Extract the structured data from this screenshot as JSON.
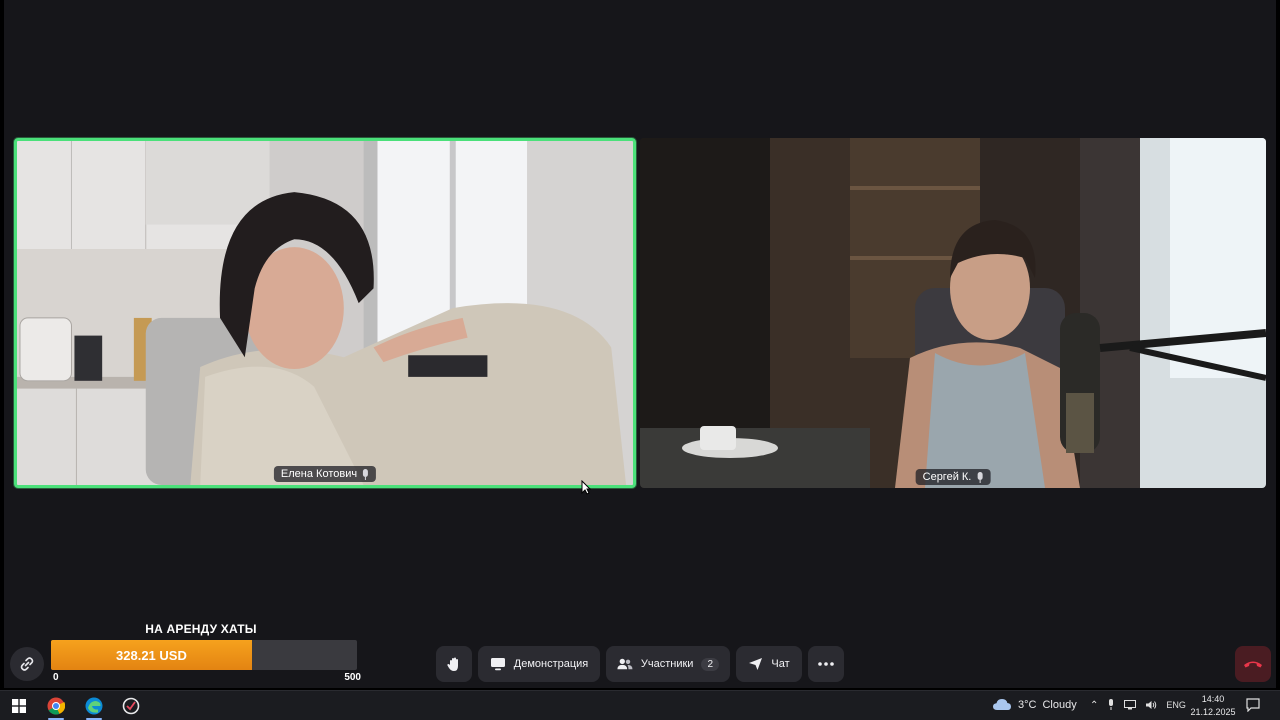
{
  "participants": [
    {
      "name": "Елена Котович",
      "speaking": true
    },
    {
      "name": "Сергей К.",
      "speaking": false
    }
  ],
  "goal": {
    "title": "НА АРЕНДУ ХАТЫ",
    "amount_label": "328.21 USD",
    "current": 328.21,
    "min_label": "0",
    "max_label": "500",
    "max": 500,
    "fill_color": "#f39a1a"
  },
  "controls": {
    "raise_hand_icon": "hand-icon",
    "demo_label": "Демонстрация",
    "participants_label": "Участники",
    "participants_count": "2",
    "chat_label": "Чат",
    "more_icon": "more-dots-icon",
    "hangup_icon": "phone-hangup-icon"
  },
  "taskbar": {
    "weather_temp": "3°C",
    "weather_text": "Cloudy",
    "language": "ENG",
    "time": "14:40",
    "date": "21.12.2025"
  },
  "colors": {
    "active_speaker_border": "#4be07a",
    "toolbar_button_bg": "#2b2b31",
    "app_background": "#16161a"
  }
}
